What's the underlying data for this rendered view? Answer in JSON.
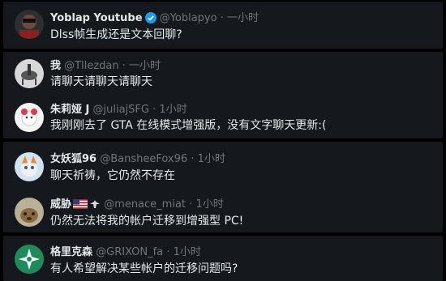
{
  "tweets": [
    {
      "name": "Yoblap Youtube",
      "handle": "@Yoblapyo",
      "dot": "·",
      "time": "一小时",
      "text": "Dlss帧生成还是文本回聊?",
      "verified": true
    },
    {
      "name": "我",
      "handle": "@Tllezdan",
      "dot": "·",
      "time": "一小时",
      "text": "请聊天请聊天请聊天"
    },
    {
      "name": "朱莉娅 J",
      "handle": "@juliajSFG",
      "dot": "·",
      "time": "1小时",
      "text": "我刚刚去了 GTA 在线模式增强版，没有文字聊天更新:("
    },
    {
      "name": "女妖狐96",
      "handle": "@BansheeFox96",
      "dot": "·",
      "time": "1小时",
      "text": "聊天祈祷，它仍然不存在"
    },
    {
      "name": "威胁",
      "handle": "@menace_miat",
      "dot": "·",
      "time": "1小时",
      "text": "仍然无法将我的帐户迁移到增强型 PC!"
    },
    {
      "name": "格里克森",
      "handle": "@GRIXON_fa",
      "dot": "·",
      "time": "1小时",
      "text": "有人希望解决某些帐户的迁移问题吗?"
    }
  ],
  "colors": {
    "background": "#000000",
    "panel": "#15181c",
    "text": "#e7e9ea",
    "muted": "#71767b",
    "verified": "#1d9bf0"
  }
}
